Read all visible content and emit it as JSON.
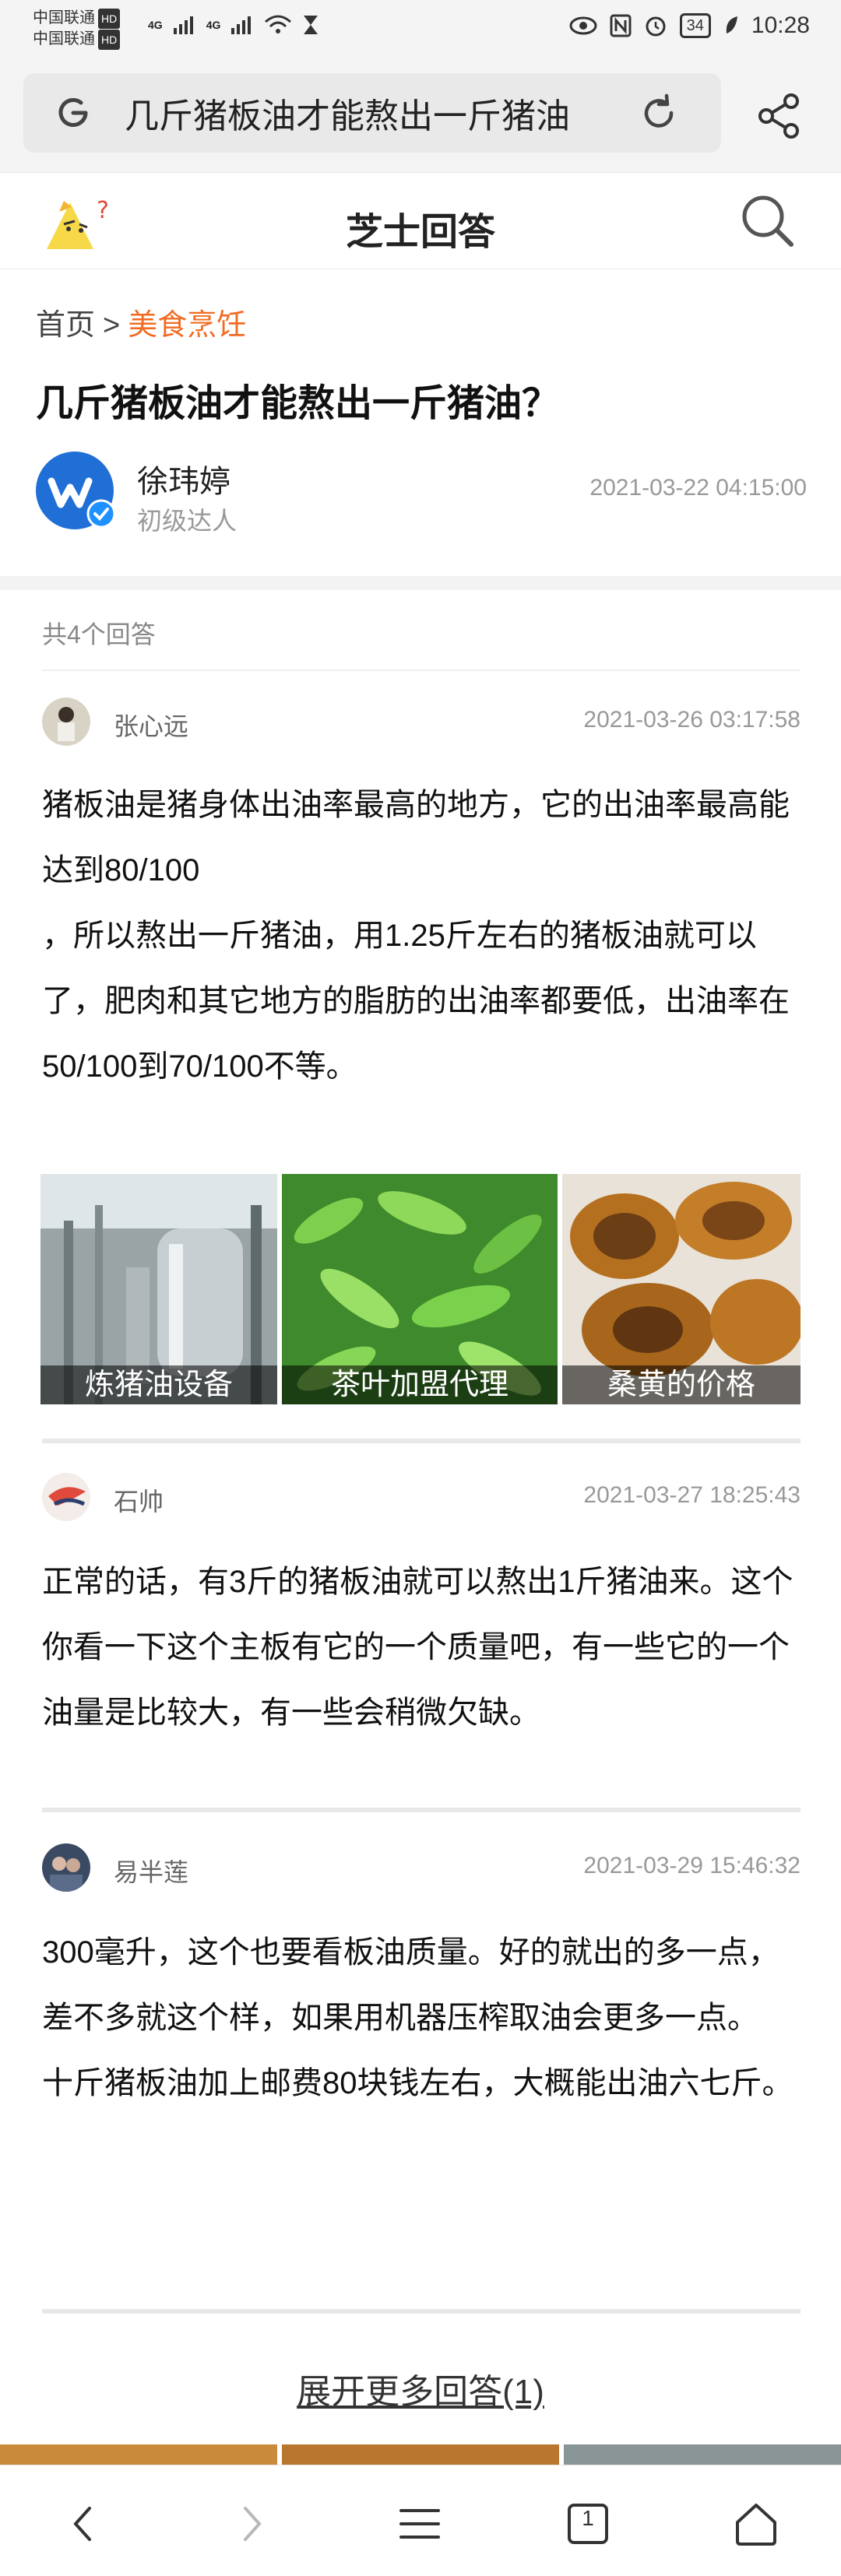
{
  "status_bar": {
    "carrier_1": "中国联通",
    "carrier_2": "中国联通",
    "hd": "HD",
    "net_1": "4G",
    "net_2": "4G",
    "battery": "34",
    "time": "10:28"
  },
  "browser": {
    "url_text": "几斤猪板油才能熬出一斤猪油",
    "icons": [
      "google-icon",
      "reload-icon",
      "share-icon"
    ]
  },
  "site": {
    "title": "芝士回答"
  },
  "breadcrumb": {
    "home": "首页",
    "separator": ">",
    "category": "美食烹饪",
    "category_color": "#f26b22"
  },
  "question": {
    "title": "几斤猪板油才能熬出一斤猪油？",
    "asker_name": "徐玮婷",
    "asker_level": "初级达人",
    "time": "2021-03-22 04:15:00"
  },
  "answer_count": "共4个回答",
  "answers": [
    {
      "name": "张心远",
      "time": "2021-03-26 03:17:58",
      "paragraphs": [
        "猪板油是猪身体出油率最高的地方，它的出油率最高能达到80/100",
        "，所以熬出一斤猪油，用1.25斤左右的猪板油就可以了，肥肉和其它地方的脂肪的出油率都要低，出油率在50/100到70/100不等。"
      ]
    },
    {
      "name": "石帅",
      "time": "2021-03-27 18:25:43",
      "paragraphs": [
        "正常的话，有3斤的猪板油就可以熬出1斤猪油来。这个你看一下这个主板有它的一个质量吧，有一些它的一个油量是比较大，有一些会稍微欠缺。"
      ]
    },
    {
      "name": "易半莲",
      "time": "2021-03-29 15:46:32",
      "paragraphs": [
        "300毫升，这个也要看板油质量。好的就出的多一点，差不多就这个样，如果用机器压榨取油会更多一点。",
        "十斤猪板油加上邮费80块钱左右，大概能出油六七斤。"
      ]
    }
  ],
  "gallery": [
    {
      "caption": "炼猪油设备"
    },
    {
      "caption": "茶叶加盟代理"
    },
    {
      "caption": "桑黄的价格"
    }
  ],
  "expand_more": "展开更多回答(1)",
  "bottom_nav": {
    "tab_count": "1"
  }
}
